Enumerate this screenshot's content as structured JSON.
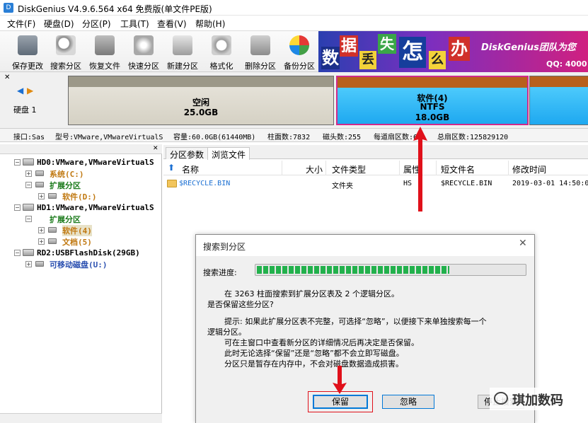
{
  "window": {
    "title": "DiskGenius V4.9.6.564 x64 免费版(单文件PE版)"
  },
  "menu": [
    "文件(F)",
    "硬盘(D)",
    "分区(P)",
    "工具(T)",
    "查看(V)",
    "帮助(H)"
  ],
  "toolbar": [
    {
      "label": "保存更改",
      "icon": "save-icon"
    },
    {
      "label": "搜索分区",
      "icon": "search-partition-icon"
    },
    {
      "label": "恢复文件",
      "icon": "recover-file-icon"
    },
    {
      "label": "快速分区",
      "icon": "quick-partition-icon"
    },
    {
      "label": "新建分区",
      "icon": "new-partition-icon"
    },
    {
      "label": "格式化",
      "icon": "format-icon"
    },
    {
      "label": "删除分区",
      "icon": "delete-partition-icon"
    },
    {
      "label": "备份分区",
      "icon": "backup-partition-icon"
    }
  ],
  "banner": {
    "chars": [
      "数",
      "据",
      "丢",
      "失",
      "怎",
      "么",
      "办"
    ],
    "brand": "DiskGenius团队为您",
    "qq": "QQ: 4000"
  },
  "disk_map": {
    "disk_label": "硬盘 1",
    "free": {
      "name": "空闲",
      "size": "25.0GB"
    },
    "selected": {
      "name": "软件(4)",
      "fs": "NTFS",
      "size": "18.0GB"
    }
  },
  "info": {
    "interface": "接口:Sas",
    "model": "型号:VMware,VMwareVirtualS",
    "capacity": "容量:60.0GB(61440MB)",
    "cylinders": "柱面数:7832",
    "heads": "磁头数:255",
    "sectors_per_track": "每道扇区数:63",
    "total_sectors": "总扇区数:125829120"
  },
  "tree": {
    "hd0": "HD0:VMware,VMwareVirtualS",
    "hd0_sys": "系统(C:)",
    "hd0_ext": "扩展分区",
    "hd0_soft": "软件(D:)",
    "hd1": "HD1:VMware,VMwareVirtualS",
    "hd1_ext": "扩展分区",
    "hd1_soft": "软件(4)",
    "hd1_doc": "文档(5)",
    "rd2": "RD2:USBFlashDisk(29GB)",
    "rd2_removable": "可移动磁盘(U:)"
  },
  "tabs": [
    "分区参数",
    "浏览文件"
  ],
  "columns": [
    "名称",
    "大小",
    "文件类型",
    "属性",
    "短文件名",
    "修改时间"
  ],
  "files": [
    {
      "name": "$RECYCLE.BIN",
      "size": "",
      "type": "文件夹",
      "attr": "HS",
      "short": "$RECYCLE.BIN",
      "modified": "2019-03-01 14:50:0"
    }
  ],
  "dialog": {
    "title": "搜索到分区",
    "progress_label": "搜索进度:",
    "progress": 0.72,
    "line1": "在 3263 柱面搜索到扩展分区表及 2 个逻辑分区。",
    "line2": "是否保留这些分区?",
    "tip1": "提示: 如果此扩展分区表不完整，可选择“忽略”，以便接下来单独搜索每一个",
    "tip2": "逻辑分区。",
    "tip3": "可在主窗口中查看新分区的详细情况后再决定是否保留。",
    "tip4": "此时无论选择“保留”还是“忽略”都不会立即写磁盘。",
    "tip5": "分区只是暂存在内存中，不会对磁盘数据造成损害。",
    "btn_keep": "保留",
    "btn_ignore": "忽略",
    "btn_stop": "停止搜索"
  },
  "watermark": "琪加数码",
  "colors": {
    "accent": "#0078d7",
    "progress": "#22b14c",
    "annotation": "#e0101a",
    "selected_partition": "#1ea8f0"
  }
}
